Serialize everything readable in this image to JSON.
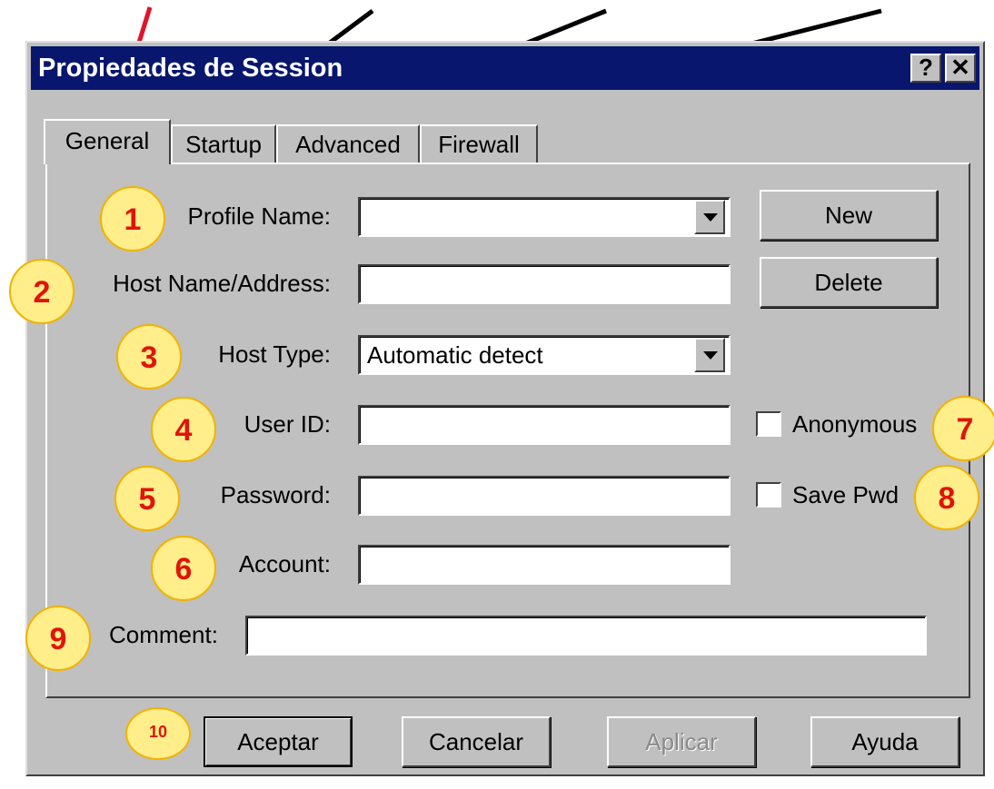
{
  "window": {
    "title": "Propiedades de Session",
    "help_button": "?",
    "close_button": "✕"
  },
  "tabs": [
    {
      "label": "General",
      "active": true
    },
    {
      "label": "Startup"
    },
    {
      "label": "Advanced"
    },
    {
      "label": "Firewall"
    }
  ],
  "form": {
    "profile_name": {
      "label": "Profile Name:",
      "value": ""
    },
    "host_name": {
      "label": "Host Name/Address:",
      "value": ""
    },
    "host_type": {
      "label": "Host Type:",
      "value": "Automatic detect"
    },
    "user_id": {
      "label": "User ID:",
      "value": ""
    },
    "password": {
      "label": "Password:",
      "value": ""
    },
    "account": {
      "label": "Account:",
      "value": ""
    },
    "comment": {
      "label": "Comment:",
      "value": ""
    },
    "anonymous": {
      "label": "Anonymous",
      "checked": false
    },
    "save_pwd": {
      "label": "Save Pwd",
      "checked": false
    }
  },
  "side_buttons": {
    "new": "New",
    "delete": "Delete"
  },
  "footer_buttons": {
    "ok": "Aceptar",
    "cancel": "Cancelar",
    "apply": "Aplicar",
    "help": "Ayuda"
  },
  "annotations": [
    "1",
    "2",
    "3",
    "4",
    "5",
    "6",
    "7",
    "8",
    "9",
    "10"
  ],
  "colors": {
    "titlebar": "#08166e",
    "face": "#c0c0c0",
    "badge_fill": "#ffee8a",
    "badge_text": "#e0140a",
    "arrow_red": "#e0142a"
  }
}
